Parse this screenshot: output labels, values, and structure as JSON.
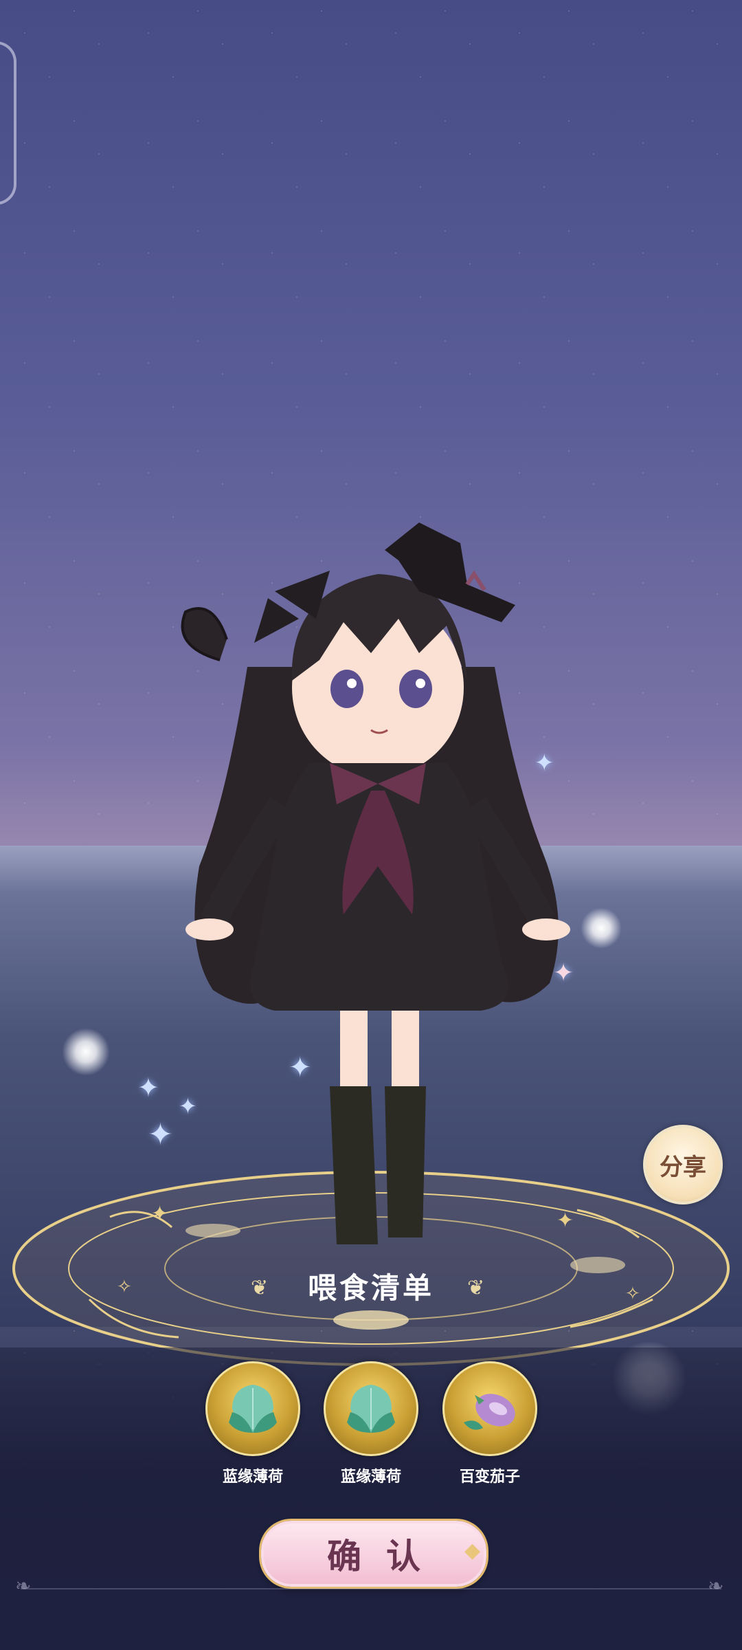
{
  "share": {
    "label": "分享"
  },
  "panel": {
    "title": "喂食清单",
    "foods": [
      {
        "name": "蓝缘薄荷",
        "icon": "mint-leaf-icon"
      },
      {
        "name": "蓝缘薄荷",
        "icon": "mint-leaf-icon"
      },
      {
        "name": "百变茄子",
        "icon": "eggplant-icon"
      }
    ],
    "confirm_label": "确认"
  },
  "colors": {
    "accent": "#f2bfd2",
    "gold": "#caa034",
    "panel_bg": "#1e2140"
  }
}
